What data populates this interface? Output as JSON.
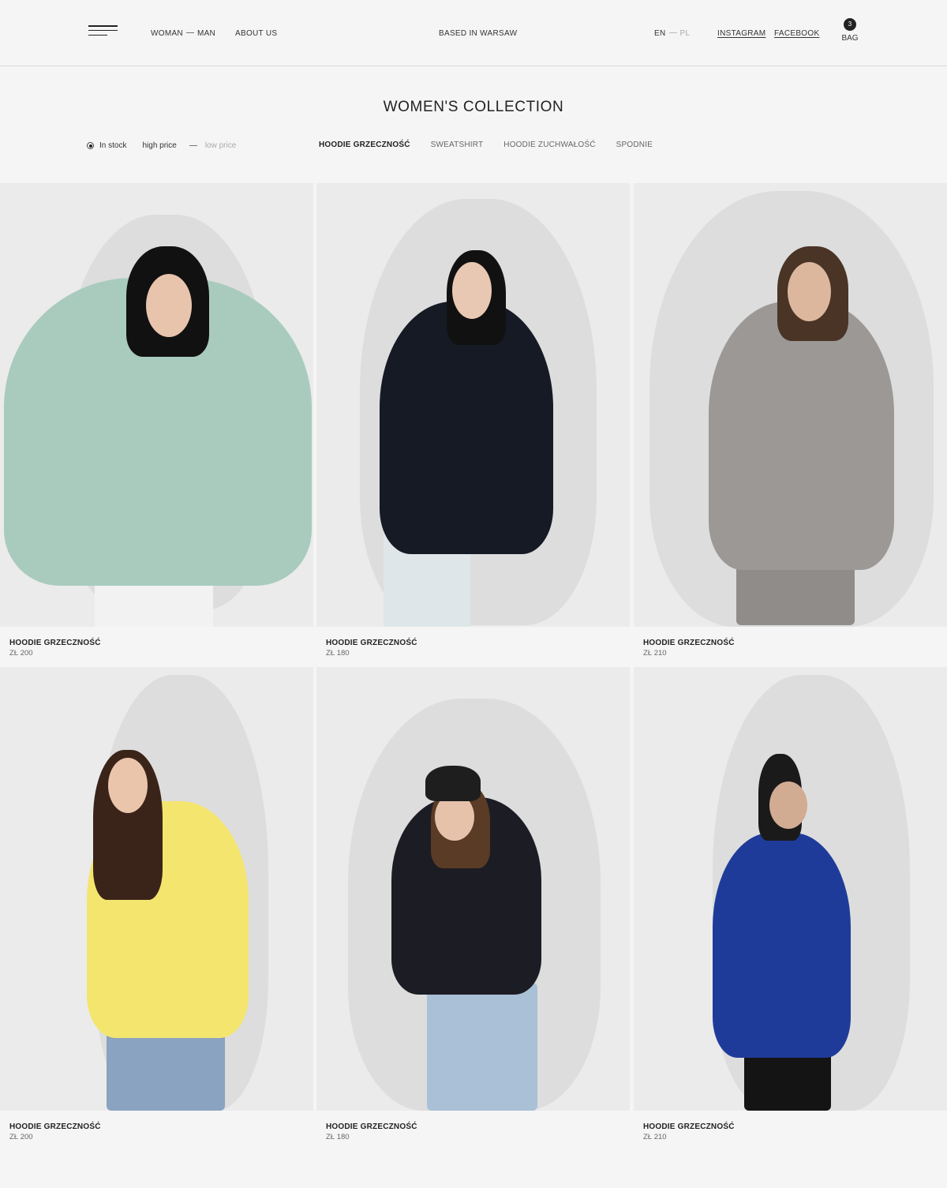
{
  "header": {
    "nav_woman": "WOMAN",
    "nav_man": "MAN",
    "nav_about": "ABOUT US",
    "tagline": "BASED IN WARSAW",
    "lang_en": "EN",
    "lang_pl": "PL",
    "instagram": "INSTAGRAM",
    "facebook": "FACEBOOK",
    "bag_count": "3",
    "bag_label": "BAG"
  },
  "page_title": "WOMEN'S COLLECTION",
  "filters": {
    "in_stock": "In stock",
    "high_price": "high price",
    "low_price": "low price"
  },
  "categories": [
    {
      "label": "HOODIE GRZECZNOŚĆ",
      "active": true
    },
    {
      "label": "SWEATSHIRT",
      "active": false
    },
    {
      "label": "HOODIE ZUCHWAŁOŚĆ",
      "active": false
    },
    {
      "label": "SPODNIE",
      "active": false
    }
  ],
  "products": [
    {
      "name": "HOODIE GRZECZNOŚĆ",
      "price": "ZŁ 200",
      "hoodie_color": "#a9cbbd",
      "pants_color": "#f2f2f2",
      "hair_color": "#111111"
    },
    {
      "name": "HOODIE GRZECZNOŚĆ",
      "price": "ZŁ 180",
      "hoodie_color": "#161a24",
      "pants_color": "#dfe6ea",
      "hair_color": "#111111"
    },
    {
      "name": "HOODIE GRZECZNOŚĆ",
      "price": "ZŁ 210",
      "hoodie_color": "#9b9896",
      "pants_color": "#8f8c8a",
      "hair_color": "#4a3426"
    },
    {
      "name": "HOODIE GRZECZNOŚĆ",
      "price": "ZŁ 200",
      "hoodie_color": "#f4e56e",
      "pants_color": "#8aa3c0",
      "hair_color": "#3a2419"
    },
    {
      "name": "HOODIE GRZECZNOŚĆ",
      "price": "ZŁ 180",
      "hoodie_color": "#1c1d24",
      "pants_color": "#a9c0d6",
      "hair_color": "#5a3b25"
    },
    {
      "name": "HOODIE GRZECZNOŚĆ",
      "price": "ZŁ 210",
      "hoodie_color": "#1f3b9a",
      "pants_color": "#141414",
      "hair_color": "#1a1a1a"
    }
  ]
}
